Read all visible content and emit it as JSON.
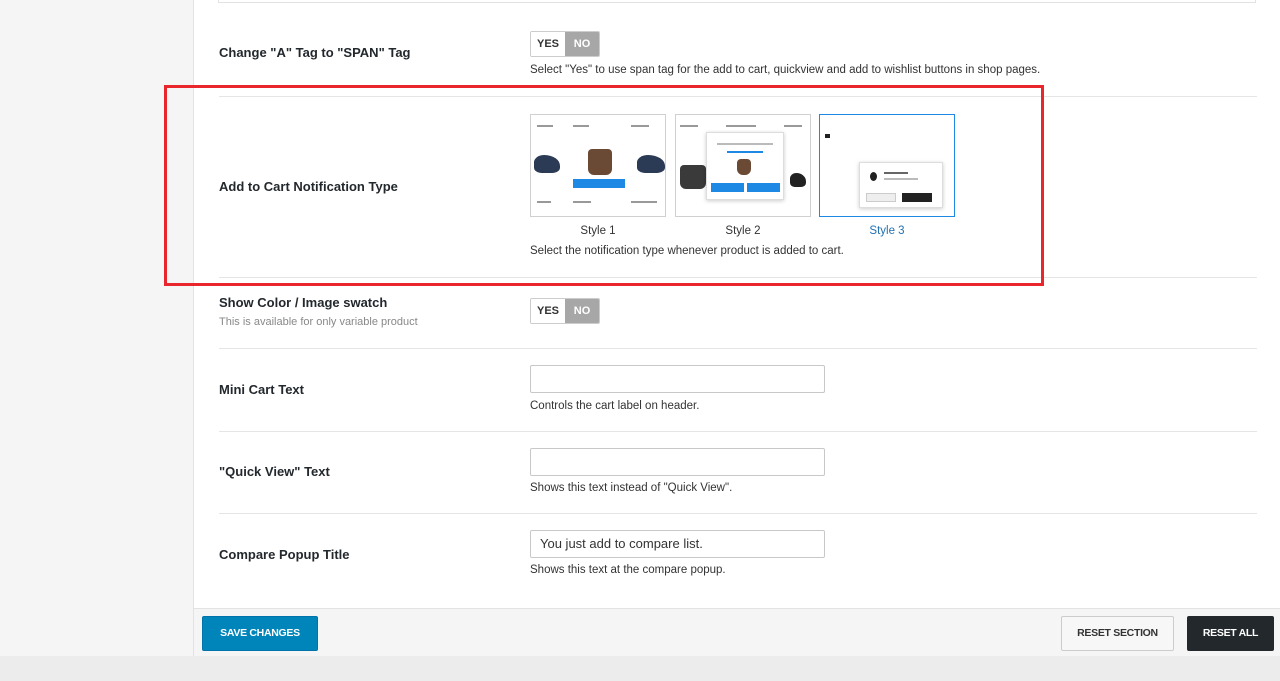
{
  "settings": {
    "span_tag": {
      "title": "Change \"A\" Tag to \"SPAN\" Tag",
      "yes": "YES",
      "no": "NO",
      "selected": "NO",
      "description": "Select \"Yes\" to use span tag for the add to cart, quickview and add to wishlist buttons in shop pages."
    },
    "notification_type": {
      "title": "Add to Cart Notification Type",
      "options": [
        {
          "label": "Style 1"
        },
        {
          "label": "Style 2"
        },
        {
          "label": "Style 3"
        }
      ],
      "selected": "Style 3",
      "description": "Select the notification type whenever product is added to cart."
    },
    "swatch": {
      "title": "Show Color / Image swatch",
      "subtitle": "This is available for only variable product",
      "yes": "YES",
      "no": "NO",
      "selected": "NO"
    },
    "mini_cart": {
      "title": "Mini Cart Text",
      "value": "",
      "description": "Controls the cart label on header."
    },
    "quick_view": {
      "title": "\"Quick View\" Text",
      "value": "",
      "description": "Shows this text instead of \"Quick View\"."
    },
    "compare_popup": {
      "title": "Compare Popup Title",
      "value": "You just add to compare list.",
      "description": "Shows this text at the compare popup."
    }
  },
  "footer": {
    "save": "SAVE CHANGES",
    "reset_section": "RESET SECTION",
    "reset_all": "RESET ALL"
  },
  "colors": {
    "accent": "#0085ba",
    "highlight": "#e8262c",
    "selected_style": "#2271b1"
  }
}
